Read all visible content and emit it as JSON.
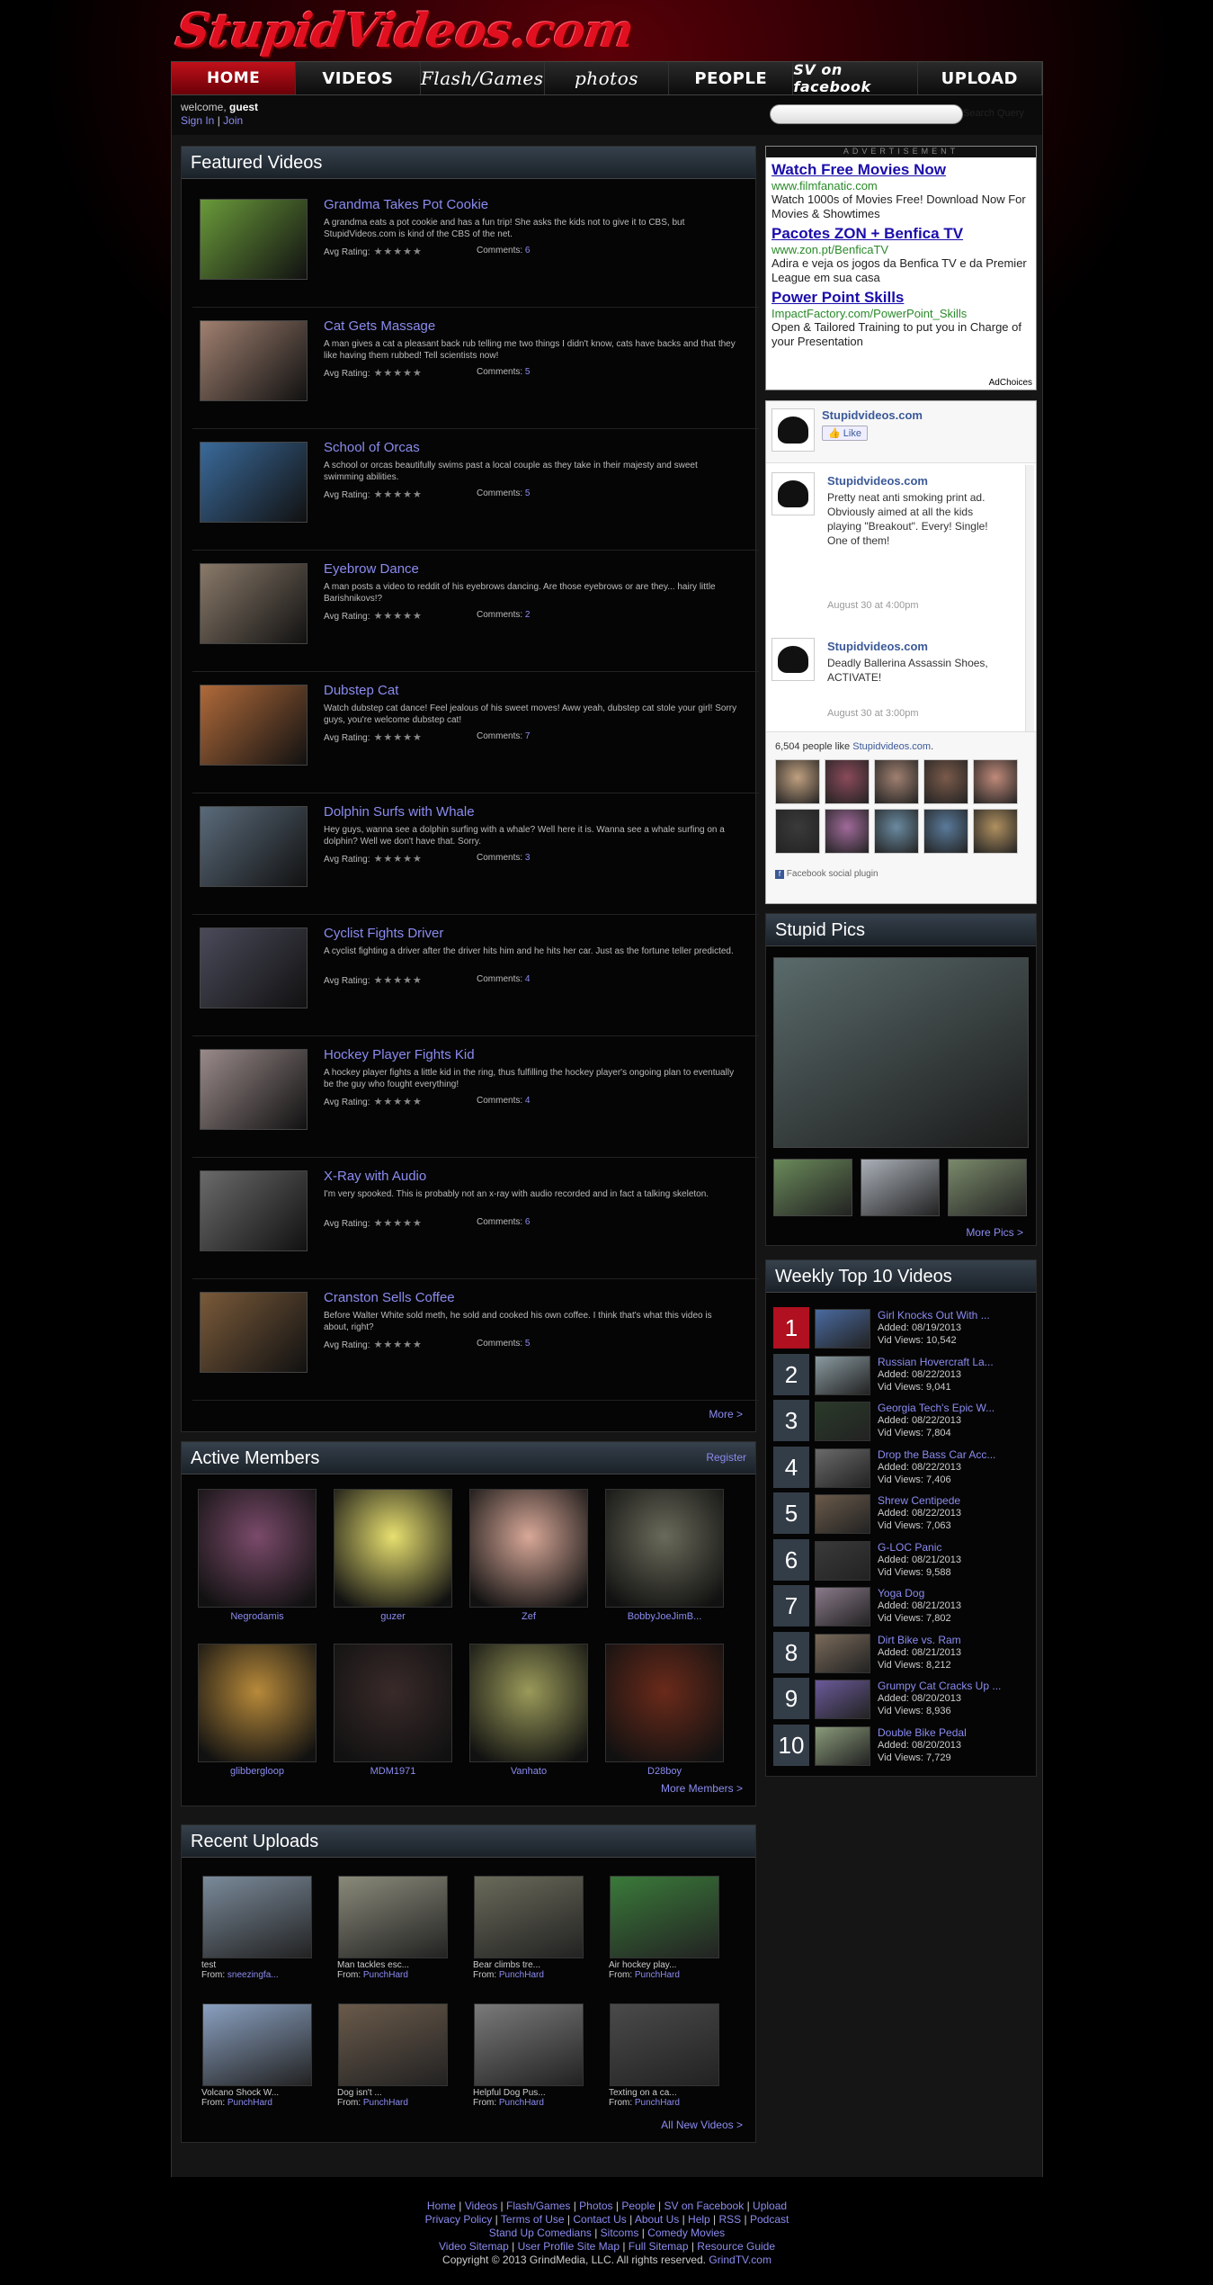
{
  "site": {
    "logo": "StupidVideos.com"
  },
  "nav": [
    "HOME",
    "VIDEOS",
    "Flash/Games",
    "photos",
    "PEOPLE",
    "SV on facebook",
    "UPLOAD"
  ],
  "user": {
    "welcome": "welcome,",
    "name": "guest",
    "sign_in": "Sign In",
    "sep": "|",
    "join": "Join",
    "search_label": "Search Query"
  },
  "featured": {
    "title": "Featured Videos",
    "rating_label": "Avg Rating:",
    "comments_label": "Comments:",
    "more": "More >",
    "videos": [
      {
        "title": "Grandma Takes Pot Cookie",
        "desc": "A grandma eats a pot cookie and has a fun trip! She asks the kids not to give it to CBS, but StupidVideos.com is kind of the CBS of the net.",
        "comments": "6",
        "thumb": "#6a9a3a"
      },
      {
        "title": "Cat Gets Massage",
        "desc": "A man gives a cat a pleasant back rub telling me two things I didn't know, cats have backs and that they like having them rubbed! Tell scientists now!",
        "comments": "5",
        "thumb": "#a08070"
      },
      {
        "title": "School of Orcas",
        "desc": "A school or orcas beautifully swims past a local couple as they take in their majesty and sweet swimming abilities.",
        "comments": "5",
        "thumb": "#3a6a9a"
      },
      {
        "title": "Eyebrow Dance",
        "desc": "A man posts a video to reddit of his eyebrows dancing. Are those eyebrows or are they... hairy little Barishnikovs!?",
        "comments": "2",
        "thumb": "#8a7a6a"
      },
      {
        "title": "Dubstep Cat",
        "desc": "Watch dubstep cat dance! Feel jealous of his sweet moves! Aww yeah, dubstep cat stole your girl! Sorry guys, you're welcome dubstep cat!",
        "comments": "7",
        "thumb": "#b06a3a"
      },
      {
        "title": "Dolphin Surfs with Whale",
        "desc": "Hey guys, wanna see a dolphin surfing with a whale? Well here it is. Wanna see a whale surfing on a dolphin? Well we don't have that. Sorry.",
        "comments": "3",
        "thumb": "#5a6a7a"
      },
      {
        "title": "Cyclist Fights Driver",
        "desc": "A cyclist fighting a driver after the driver hits him and he hits her car. Just as the fortune teller predicted.",
        "comments": "4",
        "thumb": "#4a4a5a"
      },
      {
        "title": "Hockey Player Fights Kid",
        "desc": "A hockey player fights a little kid in the ring, thus fulfilling the hockey player's ongoing plan to eventually be the guy who fought everything!",
        "comments": "4",
        "thumb": "#9a8a8a"
      },
      {
        "title": "X-Ray with Audio",
        "desc": "I'm very spooked. This is probably not an x-ray with audio recorded and in fact a talking skeleton.",
        "comments": "6",
        "thumb": "#6a6a6a"
      },
      {
        "title": "Cranston Sells Coffee",
        "desc": "Before Walter White sold meth, he sold and cooked his own coffee. I think that's what this video is about, right?",
        "comments": "5",
        "thumb": "#7a5a3a"
      }
    ]
  },
  "members": {
    "title": "Active Members",
    "register": "Register",
    "more": "More Members >",
    "list": [
      {
        "name": "Negrodamis",
        "color": "#7a4a6a"
      },
      {
        "name": "guzer",
        "color": "#e8e070"
      },
      {
        "name": "Zef",
        "color": "#d8a898"
      },
      {
        "name": "BobbyJoeJimB...",
        "color": "#6a6a5a"
      },
      {
        "name": "glibbergloop",
        "color": "#b88a3a"
      },
      {
        "name": "MDM1971",
        "color": "#3a2a2a"
      },
      {
        "name": "Vanhato",
        "color": "#9a9a5a"
      },
      {
        "name": "D28boy",
        "color": "#6a2a1a"
      }
    ]
  },
  "uploads": {
    "title": "Recent Uploads",
    "from_label": "From:",
    "more": "All New Videos >",
    "list": [
      {
        "title": "test",
        "from": "sneezingfa...",
        "color": "#7a8a9a"
      },
      {
        "title": "Man tackles esc...",
        "from": "PunchHard",
        "color": "#8a8a7a"
      },
      {
        "title": "Bear climbs tre...",
        "from": "PunchHard",
        "color": "#6a6a5a"
      },
      {
        "title": "Air hockey play...",
        "from": "PunchHard",
        "color": "#3a7a3a"
      },
      {
        "title": "Volcano Shock W...",
        "from": "PunchHard",
        "color": "#8aa0c0"
      },
      {
        "title": "Dog isn't ...",
        "from": "PunchHard",
        "color": "#6a5a4a"
      },
      {
        "title": "Helpful Dog Pus...",
        "from": "PunchHard",
        "color": "#7a7a7a"
      },
      {
        "title": "Texting on a ca...",
        "from": "PunchHard",
        "color": "#4a4a4a"
      }
    ]
  },
  "ad": {
    "label": "ADVERTISEMENT",
    "items": [
      {
        "title": "Watch Free Movies Now",
        "url": "www.filmfanatic.com",
        "desc": "Watch 1000s of Movies Free! Download Now For Movies & Showtimes"
      },
      {
        "title": "Pacotes ZON + Benfica TV",
        "url": "www.zon.pt/BenficaTV",
        "desc": "Adira e veja os jogos da Benfica TV e da Premier League em sua casa"
      },
      {
        "title": "Power Point Skills",
        "url": "ImpactFactory.com/PowerPoint_Skills",
        "desc": "Open & Tailored Training to put you in Charge of your Presentation"
      }
    ],
    "adchoices": "AdChoices"
  },
  "facebook": {
    "page": "Stupidvideos.com",
    "like": "Like",
    "posts": [
      {
        "name": "Stupidvideos.com",
        "text": "Pretty neat anti smoking print ad. Obviously aimed at all the kids playing \"Breakout\". Every! Single! One of them!",
        "date": "August 30 at 4:00pm"
      },
      {
        "name": "Stupidvideos.com",
        "text": "Deadly Ballerina Assassin Shoes, ACTIVATE!",
        "date": "August 30 at 3:00pm"
      }
    ],
    "count_pre": "6,504 people like",
    "count_link": "Stupidvideos.com",
    "faces": [
      "#c0a080",
      "#8a4a5a",
      "#a08070",
      "#7a5a4a",
      "#c08a7a",
      "#3a3a3a",
      "#a06a9a",
      "#6a8aa0",
      "#5a7a9a",
      "#b09060"
    ],
    "plugin": "Facebook social plugin"
  },
  "pics": {
    "title": "Stupid Pics",
    "more": "More Pics >",
    "main_color": "#5a6a6a",
    "thumbs": [
      "#6a8a5a",
      "#aab0b8",
      "#7a8a6a"
    ]
  },
  "top10": {
    "title": "Weekly Top 10 Videos",
    "added_label": "Added:",
    "views_label": "Vid Views:",
    "list": [
      {
        "n": "1",
        "title": "Girl Knocks Out With ...",
        "added": "08/19/2013",
        "views": "10,542",
        "color": "#4a6aa0"
      },
      {
        "n": "2",
        "title": "Russian Hovercraft La...",
        "added": "08/22/2013",
        "views": "9,041",
        "color": "#8a9aa0"
      },
      {
        "n": "3",
        "title": "Georgia Tech's Epic W...",
        "added": "08/22/2013",
        "views": "7,804",
        "color": "#2a3a2a"
      },
      {
        "n": "4",
        "title": "Drop the Bass Car Acc...",
        "added": "08/22/2013",
        "views": "7,406",
        "color": "#6a6a6a"
      },
      {
        "n": "5",
        "title": "Shrew Centipede",
        "added": "08/22/2013",
        "views": "7,063",
        "color": "#6a5a4a"
      },
      {
        "n": "6",
        "title": "G-LOC Panic",
        "added": "08/21/2013",
        "views": "9,588",
        "color": "#3a3a3a"
      },
      {
        "n": "7",
        "title": "Yoga Dog",
        "added": "08/21/2013",
        "views": "7,802",
        "color": "#8a7a8a"
      },
      {
        "n": "8",
        "title": "Dirt Bike vs. Ram",
        "added": "08/21/2013",
        "views": "8,212",
        "color": "#7a6a5a"
      },
      {
        "n": "9",
        "title": "Grumpy Cat Cracks Up ...",
        "added": "08/20/2013",
        "views": "8,936",
        "color": "#6a5a9a"
      },
      {
        "n": "10",
        "title": "Double Bike Pedal",
        "added": "08/20/2013",
        "views": "7,729",
        "color": "#8a9a7a"
      }
    ]
  },
  "footer": {
    "line1": [
      "Home",
      "Videos",
      "Flash/Games",
      "Photos",
      "People",
      "SV on Facebook",
      "Upload"
    ],
    "line2": [
      "Privacy Policy",
      "Terms of Use",
      "Contact Us",
      "About Us",
      "Help",
      "RSS",
      "Podcast"
    ],
    "line3": [
      "Stand Up Comedians",
      "Sitcoms",
      "Comedy Movies"
    ],
    "line4": [
      "Video Sitemap",
      "User Profile Site Map",
      "Full Sitemap",
      "Resource Guide"
    ],
    "copyright": "Copyright © 2013 GrindMedia, LLC. All rights reserved.",
    "grindtv": "GrindTV.com"
  }
}
